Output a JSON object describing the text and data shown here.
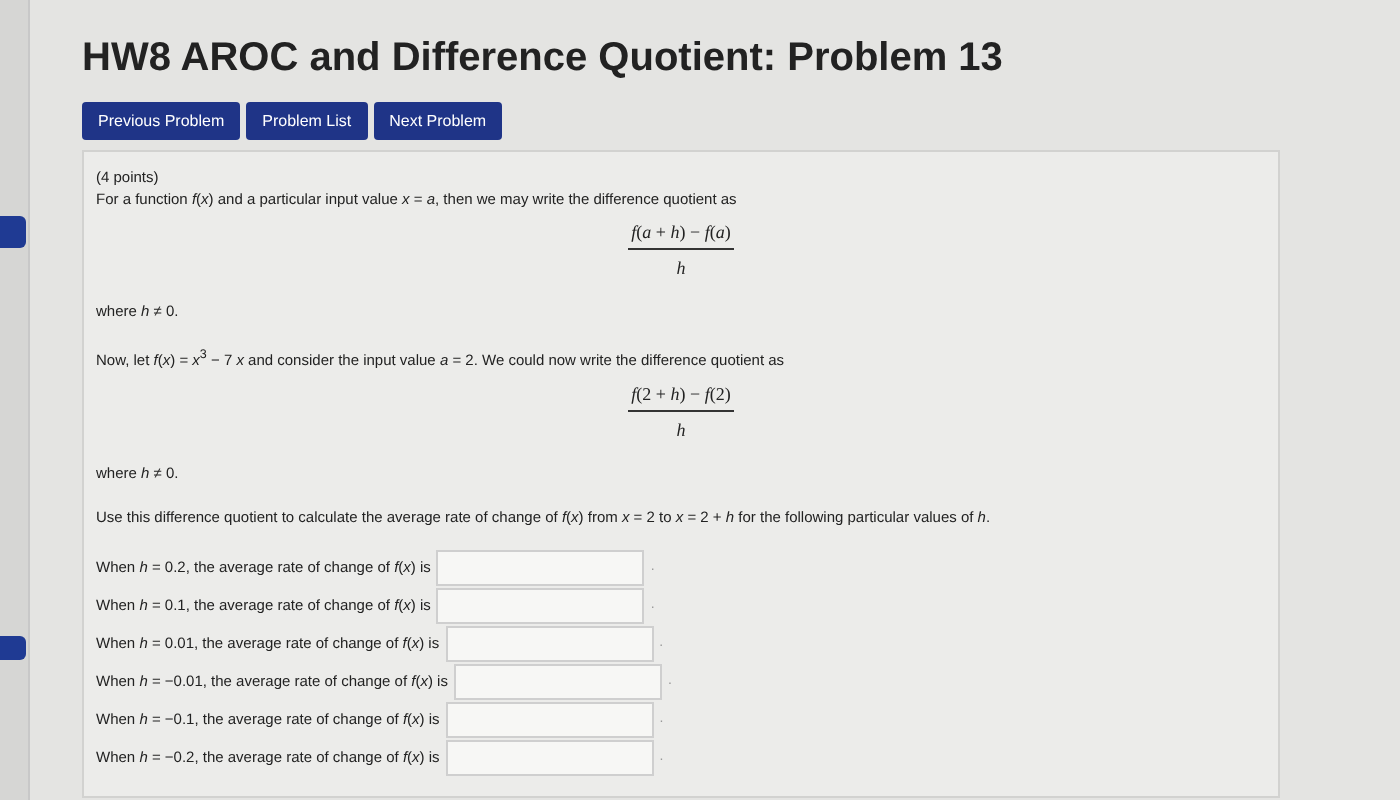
{
  "title": "HW8 AROC and Difference Quotient: Problem 13",
  "nav_buttons": [
    "Previous Problem",
    "Problem List",
    "Next Problem"
  ],
  "problem": {
    "points": "(4 points)",
    "intro": "For a function *f*(*x*) and a particular input value *x* = *a*, then we may write the difference quotient as",
    "quotient_1": {
      "numerator": "*f*(*a* + *h*) − *f*(*a*)",
      "denominator": "*h*"
    },
    "condition_1": "where *h* ≠ 0.",
    "definition": "Now, let *f*(*x*) = *x*$^{3}$ − 7 *x* and consider the input value *a* = 2. We could now write the difference quotient as",
    "quotient_2": {
      "numerator": "*f*(2 + *h*) − *f*(2)",
      "denominator": "*h*"
    },
    "condition_2": "where *h* ≠ 0.",
    "instruction": "Use this difference quotient to calculate the average rate of change of *f*(*x*) from *x* = 2 to *x* = 2 + *h* for the following particular values of *h*.",
    "answers": [
      {
        "prompt": "When *h* = 0.2, the average rate of change of *f*(*x*) is",
        "suffix": "."
      },
      {
        "prompt": "When *h* = 0.1, the average rate of change of *f*(*x*) is",
        "suffix": "."
      },
      {
        "prompt": "When *h* = 0.01, the average rate of change of *f*(*x*) is",
        "suffix": "."
      },
      {
        "prompt": "When *h* = −0.01, the average rate of change of *f*(*x*) is",
        "suffix": "."
      },
      {
        "prompt": "When *h* = −0.1, the average rate of change of *f*(*x*) is",
        "suffix": "."
      },
      {
        "prompt": "When *h* = −0.2, the average rate of change of *f*(*x*) is",
        "suffix": "."
      }
    ]
  }
}
